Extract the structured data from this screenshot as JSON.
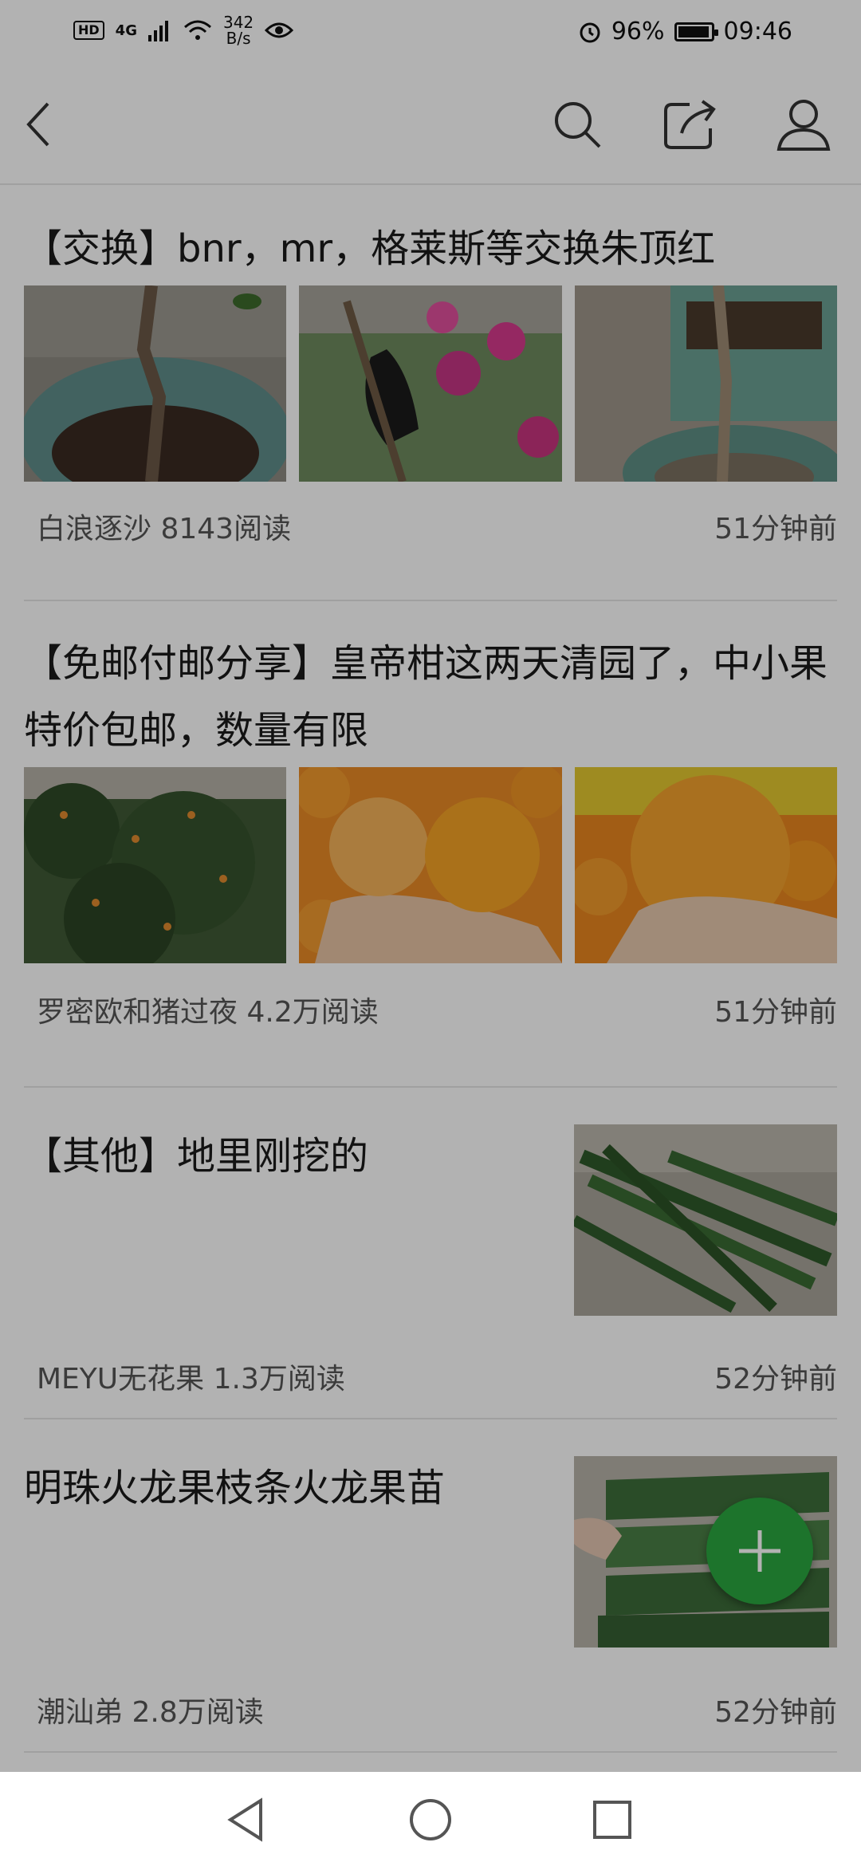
{
  "status_bar": {
    "hd": "HD",
    "network": "4G",
    "speed_value": "342",
    "speed_unit": "B/s",
    "battery_percent": "96%",
    "battery_level": 0.96,
    "time": "09:46"
  },
  "header": {
    "back_icon": "chevron-left-icon",
    "search_icon": "search-icon",
    "share_icon": "share-icon",
    "profile_icon": "user-icon"
  },
  "articles": [
    {
      "title": "【交换】bnr，mr，格莱斯等交换朱顶红",
      "author": "白浪逐沙",
      "reads": "8143阅读",
      "time": "51分钟前"
    },
    {
      "title": "【免邮付邮分享】皇帝柑这两天清园了，中小果特价包邮，数量有限",
      "author": "罗密欧和猪过夜",
      "reads": "4.2万阅读",
      "time": "51分钟前"
    },
    {
      "title": "【其他】地里刚挖的",
      "author": "MEYU无花果",
      "reads": "1.3万阅读",
      "time": "52分钟前"
    },
    {
      "title": "明珠火龙果枝条火龙果苗",
      "author": "潮汕弟",
      "reads": "2.8万阅读",
      "time": "52分钟前"
    }
  ],
  "fab": {
    "icon": "plus-icon"
  },
  "nav": {
    "back_icon": "triangle-back-icon",
    "home_icon": "circle-home-icon",
    "recent_icon": "square-recent-icon"
  },
  "colors": {
    "accent": "#2aa640",
    "overlay": "rgba(0,0,0,0.30)"
  }
}
